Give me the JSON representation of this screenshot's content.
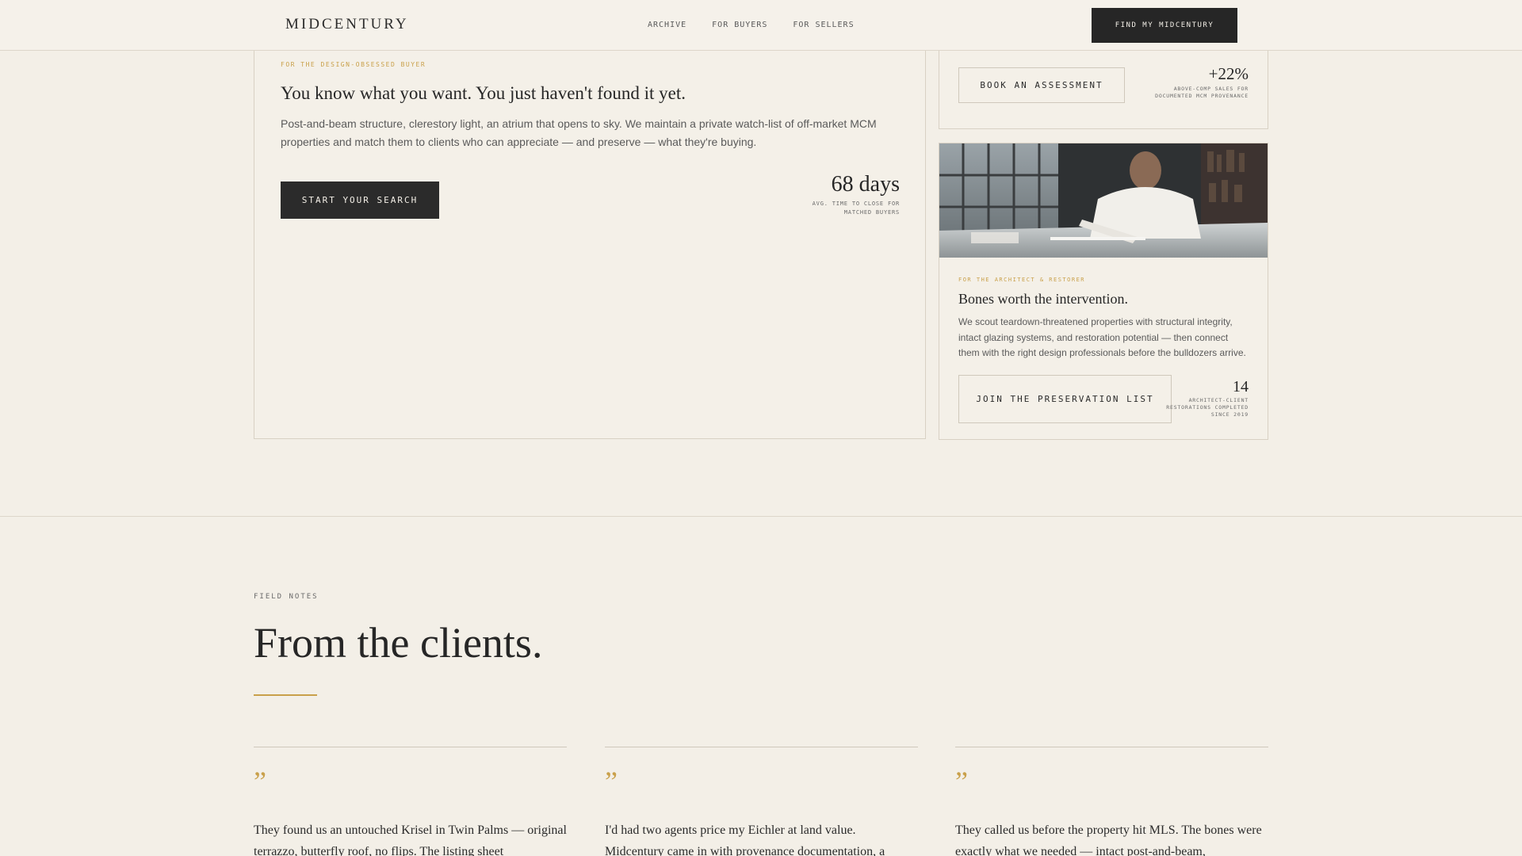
{
  "header": {
    "brand": "MIDCENTURY",
    "nav": [
      "ARCHIVE",
      "FOR BUYERS",
      "FOR SELLERS"
    ],
    "cta": "FIND MY MIDCENTURY"
  },
  "buyer_card": {
    "eyebrow": "FOR THE DESIGN-OBSESSED BUYER",
    "title": "You know what you want. You just haven't found it yet.",
    "body": "Post-and-beam structure, clerestory light, an atrium that opens to sky. We maintain a private watch-list of off-market MCM properties and match them to clients who can appreciate — and preserve — what they're buying.",
    "button": "START YOUR SEARCH",
    "stat_value": "68 days",
    "stat_caption": "AVG. TIME TO CLOSE FOR MATCHED BUYERS"
  },
  "seller_card": {
    "button": "BOOK AN ASSESSMENT",
    "stat_value": "+22%",
    "stat_caption": "ABOVE-COMP SALES FOR DOCUMENTED MCM PROVENANCE"
  },
  "architect_card": {
    "eyebrow": "FOR THE ARCHITECT & RESTORER",
    "title": "Bones worth the intervention.",
    "body": "We scout teardown-threatened properties with structural integrity, intact glazing systems, and restoration potential — then connect them with the right design professionals before the bulldozers arrive.",
    "button": "JOIN THE PRESERVATION LIST",
    "stat_value": "14",
    "stat_caption": "ARCHITECT-CLIENT RESTORATIONS COMPLETED SINCE 2019"
  },
  "field_notes": {
    "eyebrow": "FIELD NOTES",
    "title": "From the clients.",
    "quotes": [
      {
        "mark": "”",
        "text": "They found us an untouched Krisel in Twin Palms — original terrazzo, butterfly roof, no flips. The listing sheet"
      },
      {
        "mark": "”",
        "text": "I'd had two agents price my Eichler at land value. Midcentury came in with provenance documentation, a"
      },
      {
        "mark": "”",
        "text": "They called us before the property hit MLS. The bones were exactly what we needed — intact post-and-beam,"
      }
    ]
  }
}
